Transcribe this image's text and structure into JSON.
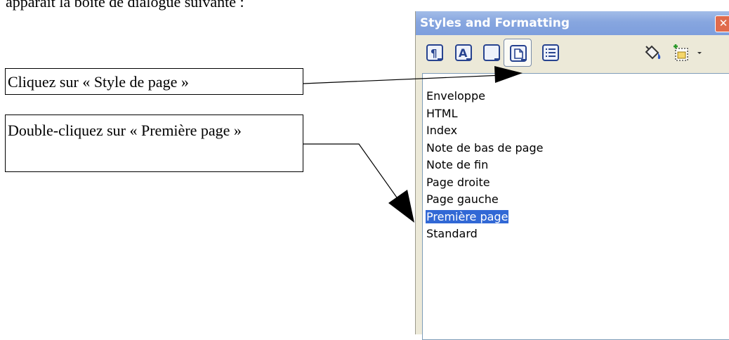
{
  "intro_text": "apparaît la boîte de dialogue suivante :",
  "callouts": [
    {
      "text": "Cliquez sur « Style de page »"
    },
    {
      "text": "Double-cliquez sur « Première page »"
    }
  ],
  "panel": {
    "title": "Styles and Formatting",
    "close_glyph": "✕",
    "toolbar": [
      {
        "name": "paragraph-styles-icon"
      },
      {
        "name": "character-styles-icon"
      },
      {
        "name": "frame-styles-icon"
      },
      {
        "name": "page-styles-icon",
        "active": true
      },
      {
        "name": "list-styles-icon"
      },
      {
        "name": "fill-format-mode-icon"
      },
      {
        "name": "new-style-from-selection-icon"
      },
      {
        "name": "dropdown-arrow-icon"
      }
    ],
    "styles": [
      {
        "label": "Enveloppe"
      },
      {
        "label": "HTML"
      },
      {
        "label": "Index"
      },
      {
        "label": "Note de bas de page"
      },
      {
        "label": "Note de fin"
      },
      {
        "label": "Page droite"
      },
      {
        "label": "Page gauche"
      },
      {
        "label": "Première page",
        "selected": true
      },
      {
        "label": "Standard"
      }
    ]
  }
}
